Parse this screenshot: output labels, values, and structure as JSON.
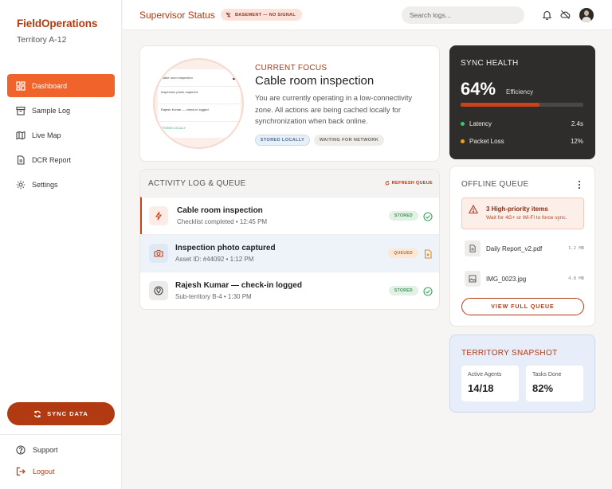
{
  "sidebar": {
    "brand": "FieldOperations",
    "territory": "Territory A-12",
    "nav": [
      {
        "label": "Dashboard",
        "icon": "dashboard-icon",
        "active": true
      },
      {
        "label": "Sample Log",
        "icon": "archive-icon"
      },
      {
        "label": "Live Map",
        "icon": "map-icon"
      },
      {
        "label": "DCR Report",
        "icon": "document-icon"
      },
      {
        "label": "Settings",
        "icon": "gear-icon"
      }
    ],
    "sync_button": "SYNC DATA",
    "support": "Support",
    "logout": "Logout"
  },
  "topbar": {
    "title": "Supervisor Status",
    "signal_badge": "BASEMENT — NO SIGNAL",
    "search_placeholder": "Search logs..."
  },
  "focus": {
    "label": "CURRENT FOCUS",
    "title": "Cable room inspection",
    "description": "You are currently operating in a low-connectivity zone. All actions are being cached locally for synchronization when back online.",
    "chips": [
      "STORED LOCALLY",
      "WAITING FOR NETWORK"
    ]
  },
  "activity": {
    "title": "ACTIVITY LOG & QUEUE",
    "refresh": "REFRESH QUEUE",
    "rows": [
      {
        "name": "Cable room inspection",
        "sub": "Checklist completed • 12:45 PM",
        "tag": "STORED",
        "icon": "bolt-icon"
      },
      {
        "name": "Inspection photo captured",
        "sub": "Asset ID: #44092 • 1:12 PM",
        "tag": "QUEUED",
        "icon": "camera-icon"
      },
      {
        "name": "Rajesh Kumar — check-in logged",
        "sub": "Sub-territory B-4 • 1:30 PM",
        "tag": "STORED",
        "icon": "location-pin-icon"
      }
    ]
  },
  "health": {
    "title": "SYNC HEALTH",
    "percent": "64%",
    "efficiency_label": "Efficiency",
    "efficiency_fraction": 0.64,
    "latency_label": "Latency",
    "latency_value": "2.4s",
    "latency_color": "#3cc56b",
    "loss_label": "Packet Loss",
    "loss_value": "12%",
    "loss_color": "#f0a11b",
    "accent": "#c9431a"
  },
  "queue": {
    "title": "OFFLINE QUEUE",
    "alert_title": "3 High-priority items",
    "alert_sub": "Wait for 4G+ or Wi-Fi to force sync.",
    "files": [
      {
        "name": "Daily Report_v2.pdf",
        "size": "1.2 MB",
        "icon": "file-icon"
      },
      {
        "name": "IMG_0023.jpg",
        "size": "4.8 MB",
        "icon": "image-icon"
      }
    ],
    "view_button": "VIEW FULL QUEUE"
  },
  "snapshot": {
    "title": "TERRITORY SNAPSHOT",
    "agents_label": "Active Agents",
    "agents_value": "14/18",
    "tasks_label": "Tasks Done",
    "tasks_value": "82%"
  }
}
